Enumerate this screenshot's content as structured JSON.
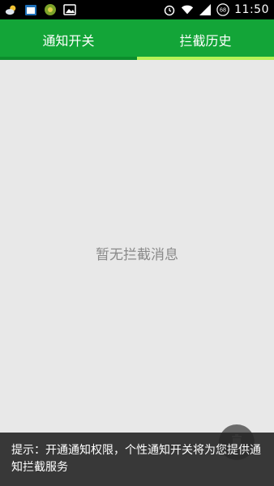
{
  "status_bar": {
    "icons_left": [
      "weather-cloud-icon",
      "calendar-icon",
      "app-badge-icon",
      "image-icon"
    ],
    "calendar_day": "1",
    "icons_right": [
      "alarm-icon",
      "wifi-icon",
      "signal-icon",
      "battery-icon"
    ],
    "battery_level": "68",
    "time": "11:50"
  },
  "tabs": [
    {
      "label": "通知开关",
      "active": false
    },
    {
      "label": "拦截历史",
      "active": true
    }
  ],
  "content": {
    "empty_message": "暂无拦截消息"
  },
  "tip": {
    "text": "提示：开通通知权限，个性通知开关将为您提供通知拦截服务"
  },
  "colors": {
    "primary_green": "#13a538",
    "tab_indicator": "#b6f257",
    "background": "#e8e8e8"
  }
}
